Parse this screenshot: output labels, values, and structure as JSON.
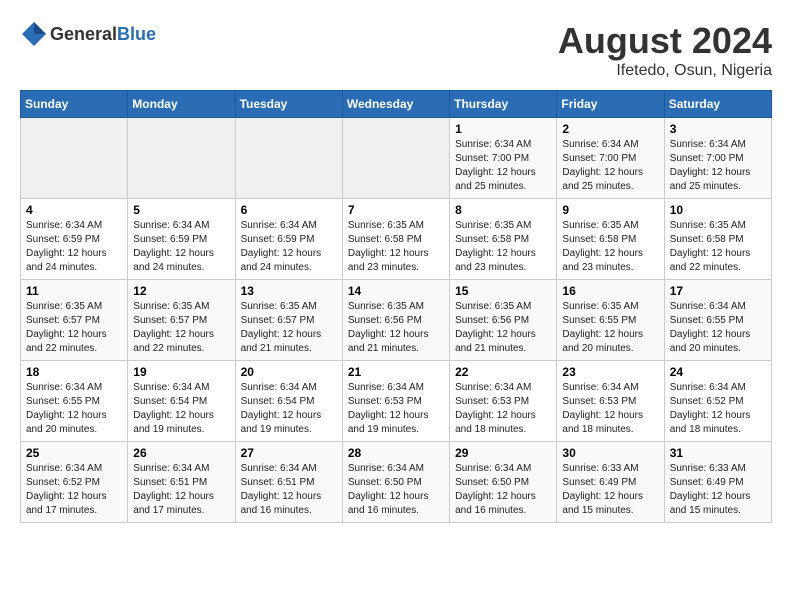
{
  "header": {
    "logo_general": "General",
    "logo_blue": "Blue",
    "month_year": "August 2024",
    "location": "Ifetedo, Osun, Nigeria"
  },
  "weekdays": [
    "Sunday",
    "Monday",
    "Tuesday",
    "Wednesday",
    "Thursday",
    "Friday",
    "Saturday"
  ],
  "weeks": [
    [
      {
        "day": "",
        "info": ""
      },
      {
        "day": "",
        "info": ""
      },
      {
        "day": "",
        "info": ""
      },
      {
        "day": "",
        "info": ""
      },
      {
        "day": "1",
        "info": "Sunrise: 6:34 AM\nSunset: 7:00 PM\nDaylight: 12 hours\nand 25 minutes."
      },
      {
        "day": "2",
        "info": "Sunrise: 6:34 AM\nSunset: 7:00 PM\nDaylight: 12 hours\nand 25 minutes."
      },
      {
        "day": "3",
        "info": "Sunrise: 6:34 AM\nSunset: 7:00 PM\nDaylight: 12 hours\nand 25 minutes."
      }
    ],
    [
      {
        "day": "4",
        "info": "Sunrise: 6:34 AM\nSunset: 6:59 PM\nDaylight: 12 hours\nand 24 minutes."
      },
      {
        "day": "5",
        "info": "Sunrise: 6:34 AM\nSunset: 6:59 PM\nDaylight: 12 hours\nand 24 minutes."
      },
      {
        "day": "6",
        "info": "Sunrise: 6:34 AM\nSunset: 6:59 PM\nDaylight: 12 hours\nand 24 minutes."
      },
      {
        "day": "7",
        "info": "Sunrise: 6:35 AM\nSunset: 6:58 PM\nDaylight: 12 hours\nand 23 minutes."
      },
      {
        "day": "8",
        "info": "Sunrise: 6:35 AM\nSunset: 6:58 PM\nDaylight: 12 hours\nand 23 minutes."
      },
      {
        "day": "9",
        "info": "Sunrise: 6:35 AM\nSunset: 6:58 PM\nDaylight: 12 hours\nand 23 minutes."
      },
      {
        "day": "10",
        "info": "Sunrise: 6:35 AM\nSunset: 6:58 PM\nDaylight: 12 hours\nand 22 minutes."
      }
    ],
    [
      {
        "day": "11",
        "info": "Sunrise: 6:35 AM\nSunset: 6:57 PM\nDaylight: 12 hours\nand 22 minutes."
      },
      {
        "day": "12",
        "info": "Sunrise: 6:35 AM\nSunset: 6:57 PM\nDaylight: 12 hours\nand 22 minutes."
      },
      {
        "day": "13",
        "info": "Sunrise: 6:35 AM\nSunset: 6:57 PM\nDaylight: 12 hours\nand 21 minutes."
      },
      {
        "day": "14",
        "info": "Sunrise: 6:35 AM\nSunset: 6:56 PM\nDaylight: 12 hours\nand 21 minutes."
      },
      {
        "day": "15",
        "info": "Sunrise: 6:35 AM\nSunset: 6:56 PM\nDaylight: 12 hours\nand 21 minutes."
      },
      {
        "day": "16",
        "info": "Sunrise: 6:35 AM\nSunset: 6:55 PM\nDaylight: 12 hours\nand 20 minutes."
      },
      {
        "day": "17",
        "info": "Sunrise: 6:34 AM\nSunset: 6:55 PM\nDaylight: 12 hours\nand 20 minutes."
      }
    ],
    [
      {
        "day": "18",
        "info": "Sunrise: 6:34 AM\nSunset: 6:55 PM\nDaylight: 12 hours\nand 20 minutes."
      },
      {
        "day": "19",
        "info": "Sunrise: 6:34 AM\nSunset: 6:54 PM\nDaylight: 12 hours\nand 19 minutes."
      },
      {
        "day": "20",
        "info": "Sunrise: 6:34 AM\nSunset: 6:54 PM\nDaylight: 12 hours\nand 19 minutes."
      },
      {
        "day": "21",
        "info": "Sunrise: 6:34 AM\nSunset: 6:53 PM\nDaylight: 12 hours\nand 19 minutes."
      },
      {
        "day": "22",
        "info": "Sunrise: 6:34 AM\nSunset: 6:53 PM\nDaylight: 12 hours\nand 18 minutes."
      },
      {
        "day": "23",
        "info": "Sunrise: 6:34 AM\nSunset: 6:53 PM\nDaylight: 12 hours\nand 18 minutes."
      },
      {
        "day": "24",
        "info": "Sunrise: 6:34 AM\nSunset: 6:52 PM\nDaylight: 12 hours\nand 18 minutes."
      }
    ],
    [
      {
        "day": "25",
        "info": "Sunrise: 6:34 AM\nSunset: 6:52 PM\nDaylight: 12 hours\nand 17 minutes."
      },
      {
        "day": "26",
        "info": "Sunrise: 6:34 AM\nSunset: 6:51 PM\nDaylight: 12 hours\nand 17 minutes."
      },
      {
        "day": "27",
        "info": "Sunrise: 6:34 AM\nSunset: 6:51 PM\nDaylight: 12 hours\nand 16 minutes."
      },
      {
        "day": "28",
        "info": "Sunrise: 6:34 AM\nSunset: 6:50 PM\nDaylight: 12 hours\nand 16 minutes."
      },
      {
        "day": "29",
        "info": "Sunrise: 6:34 AM\nSunset: 6:50 PM\nDaylight: 12 hours\nand 16 minutes."
      },
      {
        "day": "30",
        "info": "Sunrise: 6:33 AM\nSunset: 6:49 PM\nDaylight: 12 hours\nand 15 minutes."
      },
      {
        "day": "31",
        "info": "Sunrise: 6:33 AM\nSunset: 6:49 PM\nDaylight: 12 hours\nand 15 minutes."
      }
    ]
  ]
}
